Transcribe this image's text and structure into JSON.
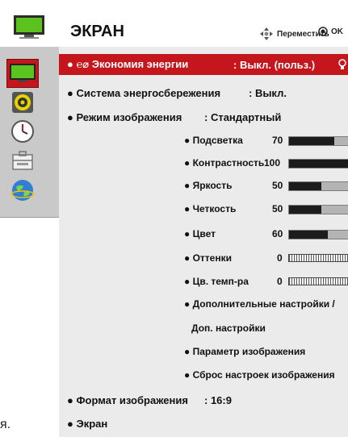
{
  "header": {
    "title": "ЭКРАН",
    "move_hint": "Переместить",
    "ok_hint": "OK"
  },
  "sidebar": {
    "items": [
      {
        "icon": "picture-icon"
      },
      {
        "icon": "sound-icon"
      },
      {
        "icon": "time-icon"
      },
      {
        "icon": "option-icon"
      },
      {
        "icon": "network-icon"
      }
    ]
  },
  "menu": {
    "energy_saving": {
      "label": "● ℮⌀ Экономия энергии",
      "value": ": Выкл. (польз.)"
    },
    "power_system": {
      "label": "● Система энергосбережения",
      "value": ": Выкл."
    },
    "picture_mode": {
      "label": "● Режим изображения",
      "value": ": Стандартный"
    },
    "backlight": {
      "label": "● Подсветка",
      "value": "70",
      "level": 70
    },
    "contrast": {
      "label": "● Контрастность",
      "value": "100",
      "level": 100
    },
    "brightness": {
      "label": "● Яркость",
      "value": "50",
      "level": 50
    },
    "sharpness": {
      "label": "● Четкость",
      "value": "50",
      "level": 50
    },
    "color": {
      "label": "● Цвет",
      "value": "60",
      "level": 60
    },
    "tint": {
      "label": "● Оттенки",
      "value": "0"
    },
    "color_temp": {
      "label": "● Цв. темп-ра",
      "value": "0"
    },
    "advanced_1": "● Дополнительные настройки /",
    "advanced_2": "Доп. настройки",
    "picture_option": "● Параметр изображения",
    "picture_reset": "● Сброс настроек изображения",
    "aspect_ratio": {
      "label": "● Формат изображения",
      "value": ": 16:9"
    },
    "screen": "● Экран"
  },
  "partial_text": "я."
}
